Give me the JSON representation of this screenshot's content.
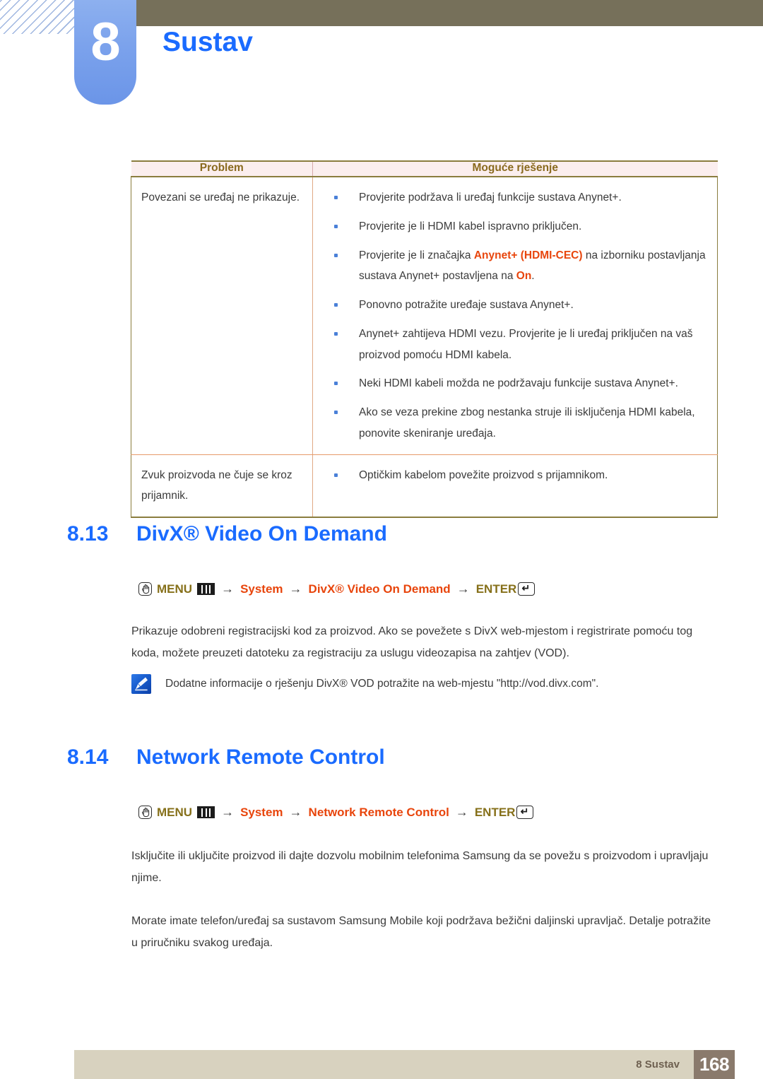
{
  "header": {
    "chapter_number": "8",
    "chapter_title": "Sustav"
  },
  "table": {
    "columns": [
      "Problem",
      "Moguće rješenje"
    ],
    "rows": [
      {
        "problem": "Povezani se uređaj ne prikazuje.",
        "solutions": [
          [
            {
              "t": "Provjerite podržava li uređaj funkcije sustava Anynet+.",
              "hl": false
            }
          ],
          [
            {
              "t": "Provjerite je li HDMI kabel ispravno priključen.",
              "hl": false
            }
          ],
          [
            {
              "t": "Provjerite je li značajka ",
              "hl": false
            },
            {
              "t": "Anynet+ (HDMI-CEC)",
              "hl": true
            },
            {
              "t": " na izborniku postavljanja sustava Anynet+ postavljena na ",
              "hl": false
            },
            {
              "t": "On",
              "hl": true
            },
            {
              "t": ".",
              "hl": false
            }
          ],
          [
            {
              "t": "Ponovno potražite uređaje sustava Anynet+.",
              "hl": false
            }
          ],
          [
            {
              "t": "Anynet+ zahtijeva HDMI vezu. Provjerite je li uređaj priključen na vaš proizvod pomoću HDMI kabela.",
              "hl": false
            }
          ],
          [
            {
              "t": "Neki HDMI kabeli možda ne podržavaju funkcije sustava Anynet+.",
              "hl": false
            }
          ],
          [
            {
              "t": "Ako se veza prekine zbog nestanka struje ili isključenja HDMI kabela, ponovite skeniranje uređaja.",
              "hl": false
            }
          ]
        ]
      },
      {
        "problem": "Zvuk proizvoda ne čuje se kroz prijamnik.",
        "solutions": [
          [
            {
              "t": "Optičkim kabelom povežite proizvod s prijamnikom.",
              "hl": false
            }
          ]
        ]
      }
    ]
  },
  "sections": [
    {
      "number": "8.13",
      "title": "DivX® Video On Demand",
      "menu_path": {
        "menu_label": "MENU",
        "arrow": "→",
        "step1": "System",
        "step2": "DivX® Video On Demand",
        "enter_label": "ENTER",
        "enter_glyph": "↵"
      },
      "paragraphs": [
        "Prikazuje odobreni registracijski kod za proizvod. Ako se povežete s DivX web-mjestom i registrirate pomoću tog koda, možete preuzeti datoteku za registraciju za uslugu videozapisa na zahtjev (VOD)."
      ],
      "note": "Dodatne informacije o rješenju DivX® VOD potražite na web-mjestu \"http://vod.divx.com\"."
    },
    {
      "number": "8.14",
      "title": "Network Remote Control",
      "menu_path": {
        "menu_label": "MENU",
        "arrow": "→",
        "step1": "System",
        "step2": "Network Remote Control",
        "enter_label": "ENTER",
        "enter_glyph": "↵"
      },
      "paragraphs": [
        "Isključite ili uključite proizvod ili dajte dozvolu mobilnim telefonima Samsung da se povežu s proizvodom i upravljaju njime.",
        "Morate imate telefon/uređaj sa sustavom Samsung Mobile koji podržava bežični daljinski upravljač. Detalje potražite u priručniku svakog uređaja."
      ]
    }
  ],
  "footer": {
    "label": "8 Sustav",
    "page_number": "168"
  },
  "colors": {
    "heading_blue": "#1a6bff",
    "menu_olive": "#86701a",
    "menu_orange": "#e8450c",
    "table_header_bg": "#fbeeee",
    "table_header_text": "#8a6a1e",
    "olive_bar": "#76705a",
    "footer_bg": "#d8d2bf",
    "footer_page_bg": "#8a7a6c",
    "bullet_blue": "#4a80d8"
  }
}
